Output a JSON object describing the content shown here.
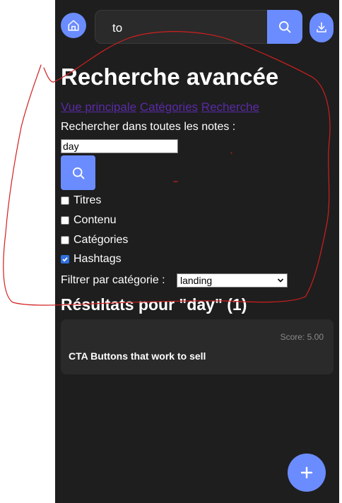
{
  "colors": {
    "accent": "#6b8cff",
    "background": "#1e1e1e",
    "card": "#2a2a2a",
    "link": "#5a2aa6",
    "annotation": "#d21f1f"
  },
  "header": {
    "search_value": "to",
    "home_icon": "home-icon",
    "search_icon": "search-icon",
    "download_icon": "download-icon"
  },
  "page": {
    "title": "Recherche avancée",
    "nav_links": [
      "Vue principale",
      "Catégories",
      "Recherche"
    ],
    "search_label": "Rechercher dans toutes les notes :",
    "search_value": "day",
    "checkboxes": [
      {
        "label": "Titres",
        "checked": false
      },
      {
        "label": "Contenu",
        "checked": false
      },
      {
        "label": "Catégories",
        "checked": false
      },
      {
        "label": "Hashtags",
        "checked": true
      }
    ],
    "filter_label": "Filtrer par catégorie :",
    "filter_value": "landing",
    "results_title": "Résultats pour \"day\" (1)"
  },
  "results": [
    {
      "score": "Score: 5.00",
      "title": "CTA Buttons that work to sell"
    }
  ],
  "fab": {
    "icon": "plus-icon"
  }
}
